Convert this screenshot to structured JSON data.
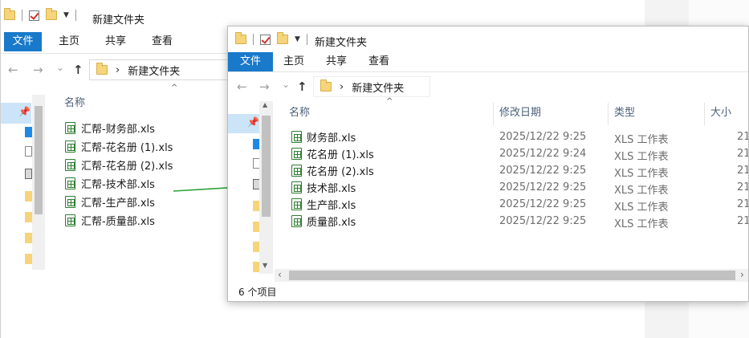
{
  "title": "新建文件夹",
  "ribbon_tabs": {
    "file": "文件",
    "home": "主页",
    "share": "共享",
    "view": "查看"
  },
  "breadcrumb_sep": "›",
  "back": {
    "column_name": "名称",
    "files": [
      "汇帮-财务部.xls",
      "汇帮-花名册 (1).xls",
      "汇帮-花名册 (2).xls",
      "汇帮-技术部.xls",
      "汇帮-生产部.xls",
      "汇帮-质量部.xls"
    ]
  },
  "front": {
    "columns": {
      "name": "名称",
      "date": "修改日期",
      "type": "类型",
      "size": "大小"
    },
    "files": [
      {
        "name": "财务部.xls",
        "date": "2025/12/22 9:25",
        "type": "XLS 工作表",
        "size": "21"
      },
      {
        "name": "花名册 (1).xls",
        "date": "2025/12/22 9:24",
        "type": "XLS 工作表",
        "size": "21"
      },
      {
        "name": "花名册 (2).xls",
        "date": "2025/12/22 9:25",
        "type": "XLS 工作表",
        "size": "21"
      },
      {
        "name": "技术部.xls",
        "date": "2025/12/22 9:25",
        "type": "XLS 工作表",
        "size": "21"
      },
      {
        "name": "生产部.xls",
        "date": "2025/12/22 9:25",
        "type": "XLS 工作表",
        "size": "21"
      },
      {
        "name": "质量部.xls",
        "date": "2025/12/22 9:25",
        "type": "XLS 工作表",
        "size": "21"
      }
    ],
    "status": "6 个项目"
  },
  "icons": {
    "nav_back": "←",
    "nav_forward": "→",
    "nav_recent": "⌄",
    "nav_up": "↑",
    "scroll_up": "▲",
    "scroll_down": "▼",
    "scroll_left": "‹",
    "scroll_right": "›",
    "pin": "📌",
    "sort_caret": "^"
  },
  "colors": {
    "file_tab": "#1979ca",
    "arrow": "#2aa33a",
    "excel": "#2e7d32"
  }
}
